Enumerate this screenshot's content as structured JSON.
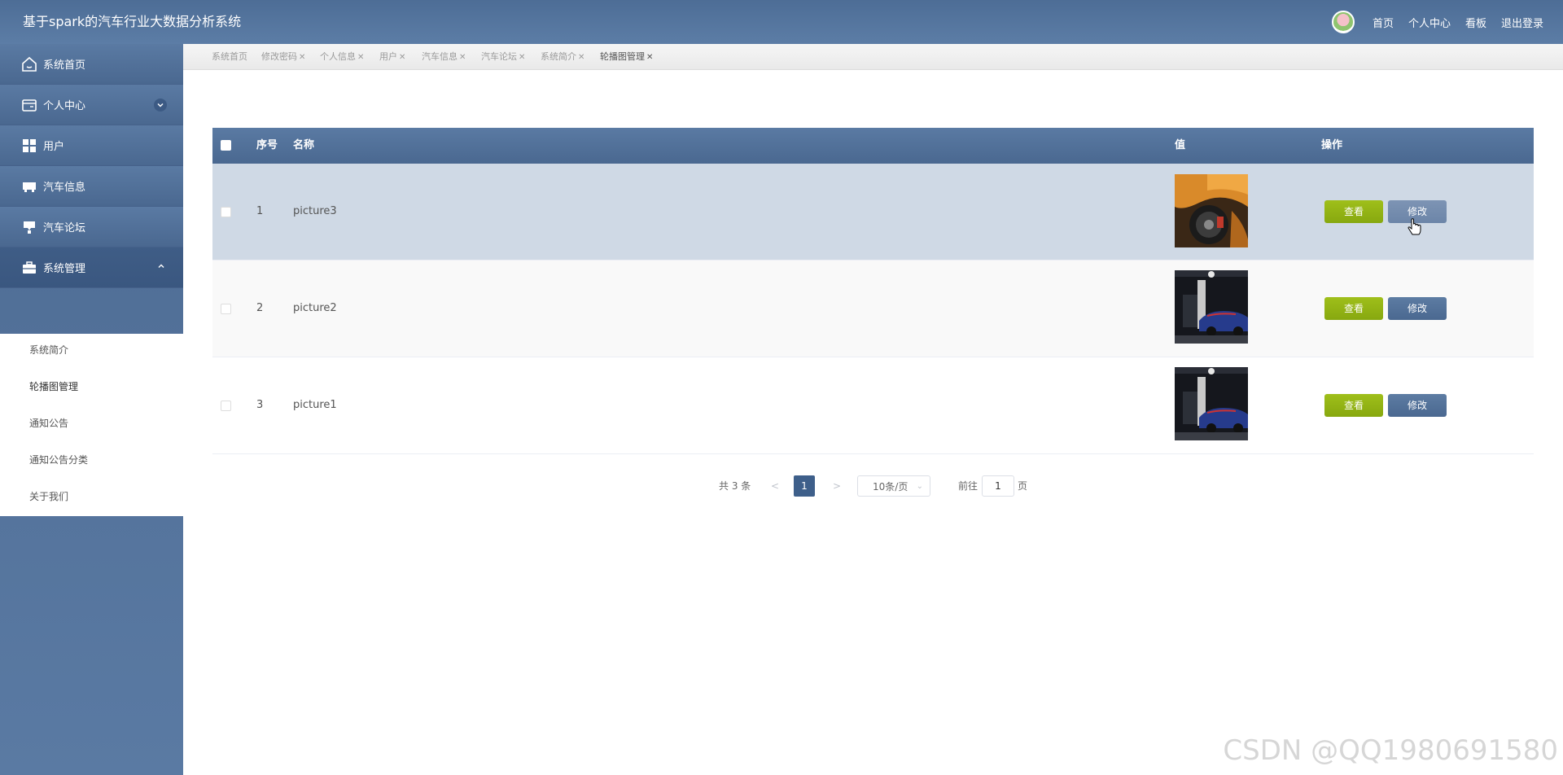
{
  "header": {
    "title": "基于spark的汽车行业大数据分析系统",
    "links": [
      "首页",
      "个人中心",
      "看板",
      "退出登录"
    ]
  },
  "sidebar": {
    "items": [
      {
        "label": "系统首页",
        "icon": "home-icon"
      },
      {
        "label": "个人中心",
        "icon": "card-icon"
      },
      {
        "label": "用户",
        "icon": "grid-icon"
      },
      {
        "label": "汽车信息",
        "icon": "car-icon"
      },
      {
        "label": "汽车论坛",
        "icon": "forum-icon"
      },
      {
        "label": "系统管理",
        "icon": "briefcase-icon"
      }
    ],
    "subitems": [
      "系统简介",
      "轮播图管理",
      "通知公告",
      "通知公告分类",
      "关于我们"
    ]
  },
  "tabs": [
    "系统首页",
    "修改密码",
    "个人信息",
    "用户",
    "汽车信息",
    "汽车论坛",
    "系统简介",
    "轮播图管理"
  ],
  "table": {
    "headers": {
      "index": "序号",
      "name": "名称",
      "value": "值",
      "actions": "操作"
    },
    "rows": [
      {
        "index": "1",
        "name": "picture3"
      },
      {
        "index": "2",
        "name": "picture2"
      },
      {
        "index": "3",
        "name": "picture1"
      }
    ],
    "view_label": "查看",
    "edit_label": "修改"
  },
  "pagination": {
    "total": "共 3 条",
    "prev": "<",
    "current": "1",
    "next": ">",
    "page_size": "10条/页",
    "goto_label": "前往",
    "goto_value": "1",
    "page_suffix": "页"
  },
  "watermark": "CSDN @QQ1980691580",
  "colors": {
    "header": "#4d6d96",
    "sidebar": "#4c6a92",
    "view_button": "#9fbf1a",
    "edit_button": "#4a6890",
    "selected_row": "#cfd9e5"
  }
}
